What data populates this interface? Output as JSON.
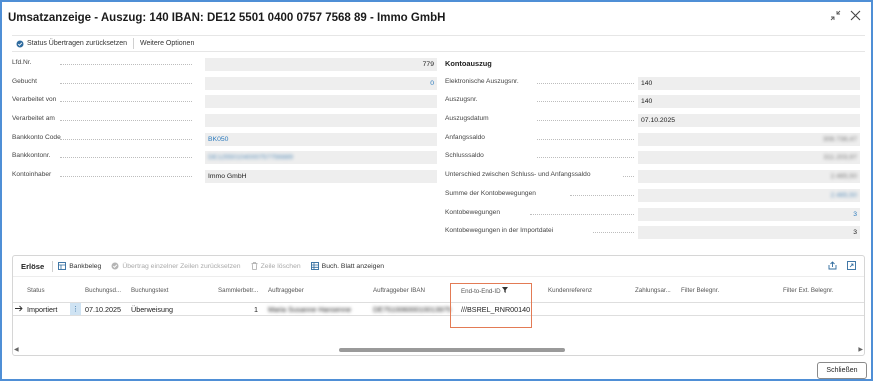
{
  "window": {
    "title": "Umsatzanzeige - Auszug: 140 IBAN: DE12 5501 0400 0757 7568 89 - Immo GmbH"
  },
  "actions": {
    "reset_status": "Status Übertragen zurücksetzen",
    "more_options": "Weitere Optionen"
  },
  "general": {
    "lfd_nr_label": "Lfd.Nr.",
    "lfd_nr_value": "779",
    "gebucht_label": "Gebucht",
    "gebucht_value": "0",
    "verarbeitet_von_label": "Verarbeitet von",
    "verarbeitet_von_value": "",
    "verarbeitet_am_label": "Verarbeitet am",
    "verarbeitet_am_value": "",
    "bankkonto_code_label": "Bankkonto Code",
    "bankkonto_code_value": "BK050",
    "bankkontonr_label": "Bankkontonr.",
    "bankkontonr_value": "DE12550104000757756889",
    "kontoinhaber_label": "Kontoinhaber",
    "kontoinhaber_value": "Immo GmbH"
  },
  "kontoauszug": {
    "header": "Kontoauszug",
    "elektronische_label": "Elektronische Auszugsnr.",
    "elektronische_value": "140",
    "auszugsnr_label": "Auszugsnr.",
    "auszugsnr_value": "140",
    "auszugsdatum_label": "Auszugsdatum",
    "auszugsdatum_value": "07.10.2025",
    "anfangssaldo_label": "Anfangssaldo",
    "anfangssaldo_value": "308.738,47",
    "schlusssaldo_label": "Schlusssaldo",
    "schlusssaldo_value": "311.203,97",
    "unterschied_label": "Unterschied zwischen Schluss- und Anfangssaldo",
    "unterschied_value": "2.465,50",
    "summe_label": "Summe der Kontobewegungen",
    "summe_value": "2.465,50",
    "kontobewegungen_label": "Kontobewegungen",
    "kontobewegungen_value": "3",
    "importdatei_label": "Kontobewegungen in der Importdatei",
    "importdatei_value": "3"
  },
  "lines": {
    "title": "Erlöse",
    "bankbeleg": "Bankbeleg",
    "reset_lines": "Übertrag einzelner Zeilen zurücksetzen",
    "delete_row": "Zeile löschen",
    "show_journal": "Buch. Blatt anzeigen",
    "columns": {
      "status": "Status",
      "buchungsdatum": "Buchungsd...",
      "buchungstext": "Buchungstext",
      "sammlerbetrag": "Sammlerbetr...",
      "auftraggeber": "Auftraggeber",
      "auftraggeber_iban": "Auftraggeber IBAN",
      "end_to_end": "End-to-End-ID",
      "kundenreferenz": "Kundenreferenz",
      "zahlungsart": "Zahlungsar...",
      "filter_belegnr": "Filter Belegnr.",
      "filter_ext_belegnr": "Filter Ext. Belegnr."
    },
    "row": {
      "status": "Importiert",
      "buchungsdatum": "07.10.2025",
      "buchungstext": "Überweisung",
      "sammlerbetrag": "1",
      "auftraggeber": "Maria Susanne Hansenne",
      "auftraggeber_iban": "DE75100600010013975",
      "end_to_end": "///BSREL_RNR00140"
    }
  },
  "footer": {
    "close": "Schließen"
  },
  "colors": {
    "accent_link": "#2d7bbd",
    "highlight_border": "#e37b55",
    "window_border": "#4f8fd6"
  }
}
